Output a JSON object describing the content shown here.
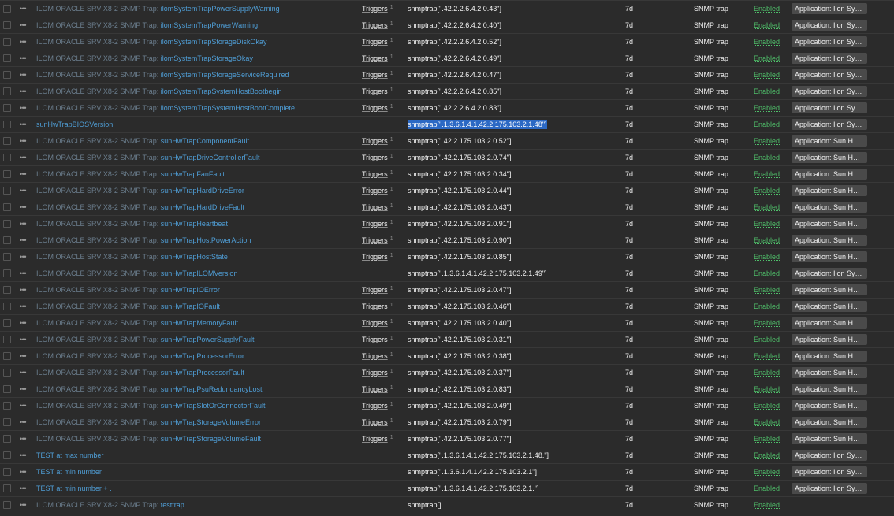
{
  "icons": {
    "row_menu": "more-dots-icon"
  },
  "colors": {
    "background": "#2b2b2b",
    "link": "#4f9ed6",
    "prefix_link": "#6b7e8e",
    "enabled": "#4fbf6a",
    "tag_bg": "#4a4a4a",
    "selection": "#2c69c4"
  },
  "menu_glyph": "•••",
  "rows": [
    {
      "prefix": "ILOM ORACLE SRV X8-2 SNMP Trap: ",
      "name": "ilomSystemTrapPowerSupplyWarning",
      "triggers": "Triggers",
      "triggers_count": "1",
      "key": "snmptrap[\".42.2.2.6.4.2.0.43\"]",
      "key_selected": false,
      "interval": "7d",
      "type": "SNMP trap",
      "status": "Enabled",
      "tag": "Application: Ilon Syste..."
    },
    {
      "prefix": "ILOM ORACLE SRV X8-2 SNMP Trap: ",
      "name": "ilomSystemTrapPowerWarning",
      "triggers": "Triggers",
      "triggers_count": "1",
      "key": "snmptrap[\".42.2.2.6.4.2.0.40\"]",
      "key_selected": false,
      "interval": "7d",
      "type": "SNMP trap",
      "status": "Enabled",
      "tag": "Application: Ilon Syste..."
    },
    {
      "prefix": "ILOM ORACLE SRV X8-2 SNMP Trap: ",
      "name": "ilomSystemTrapStorageDiskOkay",
      "triggers": "Triggers",
      "triggers_count": "1",
      "key": "snmptrap[\".42.2.2.6.4.2.0.52\"]",
      "key_selected": false,
      "interval": "7d",
      "type": "SNMP trap",
      "status": "Enabled",
      "tag": "Application: Ilon Syste..."
    },
    {
      "prefix": "ILOM ORACLE SRV X8-2 SNMP Trap: ",
      "name": "ilomSystemTrapStorageOkay",
      "triggers": "Triggers",
      "triggers_count": "1",
      "key": "snmptrap[\".42.2.2.6.4.2.0.49\"]",
      "key_selected": false,
      "interval": "7d",
      "type": "SNMP trap",
      "status": "Enabled",
      "tag": "Application: Ilon Syste..."
    },
    {
      "prefix": "ILOM ORACLE SRV X8-2 SNMP Trap: ",
      "name": "ilomSystemTrapStorageServiceRequired",
      "triggers": "Triggers",
      "triggers_count": "1",
      "key": "snmptrap[\".42.2.2.6.4.2.0.47\"]",
      "key_selected": false,
      "interval": "7d",
      "type": "SNMP trap",
      "status": "Enabled",
      "tag": "Application: Ilon Syste..."
    },
    {
      "prefix": "ILOM ORACLE SRV X8-2 SNMP Trap: ",
      "name": "ilomSystemTrapSystemHostBootbegin",
      "triggers": "Triggers",
      "triggers_count": "1",
      "key": "snmptrap[\".42.2.2.6.4.2.0.85\"]",
      "key_selected": false,
      "interval": "7d",
      "type": "SNMP trap",
      "status": "Enabled",
      "tag": "Application: Ilon Syste..."
    },
    {
      "prefix": "ILOM ORACLE SRV X8-2 SNMP Trap: ",
      "name": "ilomSystemTrapSystemHostBootComplete",
      "triggers": "Triggers",
      "triggers_count": "1",
      "key": "snmptrap[\".42.2.2.6.4.2.0.83\"]",
      "key_selected": false,
      "interval": "7d",
      "type": "SNMP trap",
      "status": "Enabled",
      "tag": "Application: Ilon Syste..."
    },
    {
      "prefix": "",
      "name": "sunHwTrapBIOSVersion",
      "triggers": "",
      "triggers_count": "",
      "key": "snmptrap[\".1.3.6.1.4.1.42.2.175.103.2.1.48\"]",
      "key_selected": true,
      "interval": "7d",
      "type": "SNMP trap",
      "status": "Enabled",
      "tag": "Application: Ilon Syste..."
    },
    {
      "prefix": "ILOM ORACLE SRV X8-2 SNMP Trap: ",
      "name": "sunHwTrapComponentFault",
      "triggers": "Triggers",
      "triggers_count": "1",
      "key": "snmptrap[\".42.2.175.103.2.0.52\"]",
      "key_selected": false,
      "interval": "7d",
      "type": "SNMP trap",
      "status": "Enabled",
      "tag": "Application: Sun HW T..."
    },
    {
      "prefix": "ILOM ORACLE SRV X8-2 SNMP Trap: ",
      "name": "sunHwTrapDriveControllerFault",
      "triggers": "Triggers",
      "triggers_count": "1",
      "key": "snmptrap[\".42.2.175.103.2.0.74\"]",
      "key_selected": false,
      "interval": "7d",
      "type": "SNMP trap",
      "status": "Enabled",
      "tag": "Application: Sun HW T..."
    },
    {
      "prefix": "ILOM ORACLE SRV X8-2 SNMP Trap: ",
      "name": "sunHwTrapFanFault",
      "triggers": "Triggers",
      "triggers_count": "1",
      "key": "snmptrap[\".42.2.175.103.2.0.34\"]",
      "key_selected": false,
      "interval": "7d",
      "type": "SNMP trap",
      "status": "Enabled",
      "tag": "Application: Sun HW T..."
    },
    {
      "prefix": "ILOM ORACLE SRV X8-2 SNMP Trap: ",
      "name": "sunHwTrapHardDriveError",
      "triggers": "Triggers",
      "triggers_count": "1",
      "key": "snmptrap[\".42.2.175.103.2.0.44\"]",
      "key_selected": false,
      "interval": "7d",
      "type": "SNMP trap",
      "status": "Enabled",
      "tag": "Application: Sun HW T..."
    },
    {
      "prefix": "ILOM ORACLE SRV X8-2 SNMP Trap: ",
      "name": "sunHwTrapHardDriveFault",
      "triggers": "Triggers",
      "triggers_count": "1",
      "key": "snmptrap[\".42.2.175.103.2.0.43\"]",
      "key_selected": false,
      "interval": "7d",
      "type": "SNMP trap",
      "status": "Enabled",
      "tag": "Application: Sun HW T..."
    },
    {
      "prefix": "ILOM ORACLE SRV X8-2 SNMP Trap: ",
      "name": "sunHwTrapHeartbeat",
      "triggers": "Triggers",
      "triggers_count": "1",
      "key": "snmptrap[\".42.2.175.103.2.0.91\"]",
      "key_selected": false,
      "interval": "7d",
      "type": "SNMP trap",
      "status": "Enabled",
      "tag": "Application: Sun HW T..."
    },
    {
      "prefix": "ILOM ORACLE SRV X8-2 SNMP Trap: ",
      "name": "sunHwTrapHostPowerAction",
      "triggers": "Triggers",
      "triggers_count": "1",
      "key": "snmptrap[\".42.2.175.103.2.0.90\"]",
      "key_selected": false,
      "interval": "7d",
      "type": "SNMP trap",
      "status": "Enabled",
      "tag": "Application: Sun HW T..."
    },
    {
      "prefix": "ILOM ORACLE SRV X8-2 SNMP Trap: ",
      "name": "sunHwTrapHostState",
      "triggers": "Triggers",
      "triggers_count": "1",
      "key": "snmptrap[\".42.2.175.103.2.0.85\"]",
      "key_selected": false,
      "interval": "7d",
      "type": "SNMP trap",
      "status": "Enabled",
      "tag": "Application: Sun HW T..."
    },
    {
      "prefix": "ILOM ORACLE SRV X8-2 SNMP Trap: ",
      "name": "sunHwTrapILOMVersion",
      "triggers": "",
      "triggers_count": "",
      "key": "snmptrap[\".1.3.6.1.4.1.42.2.175.103.2.1.49\"]",
      "key_selected": false,
      "interval": "7d",
      "type": "SNMP trap",
      "status": "Enabled",
      "tag": "Application: Ilon Syste..."
    },
    {
      "prefix": "ILOM ORACLE SRV X8-2 SNMP Trap: ",
      "name": "sunHwTrapIOError",
      "triggers": "Triggers",
      "triggers_count": "1",
      "key": "snmptrap[\".42.2.175.103.2.0.47\"]",
      "key_selected": false,
      "interval": "7d",
      "type": "SNMP trap",
      "status": "Enabled",
      "tag": "Application: Sun HW T..."
    },
    {
      "prefix": "ILOM ORACLE SRV X8-2 SNMP Trap: ",
      "name": "sunHwTrapIOFault",
      "triggers": "Triggers",
      "triggers_count": "1",
      "key": "snmptrap[\".42.2.175.103.2.0.46\"]",
      "key_selected": false,
      "interval": "7d",
      "type": "SNMP trap",
      "status": "Enabled",
      "tag": "Application: Sun HW T..."
    },
    {
      "prefix": "ILOM ORACLE SRV X8-2 SNMP Trap: ",
      "name": "sunHwTrapMemoryFault",
      "triggers": "Triggers",
      "triggers_count": "1",
      "key": "snmptrap[\".42.2.175.103.2.0.40\"]",
      "key_selected": false,
      "interval": "7d",
      "type": "SNMP trap",
      "status": "Enabled",
      "tag": "Application: Sun HW T..."
    },
    {
      "prefix": "ILOM ORACLE SRV X8-2 SNMP Trap: ",
      "name": "sunHwTrapPowerSupplyFault",
      "triggers": "Triggers",
      "triggers_count": "1",
      "key": "snmptrap[\".42.2.175.103.2.0.31\"]",
      "key_selected": false,
      "interval": "7d",
      "type": "SNMP trap",
      "status": "Enabled",
      "tag": "Application: Sun HW T..."
    },
    {
      "prefix": "ILOM ORACLE SRV X8-2 SNMP Trap: ",
      "name": "sunHwTrapProcessorError",
      "triggers": "Triggers",
      "triggers_count": "1",
      "key": "snmptrap[\".42.2.175.103.2.0.38\"]",
      "key_selected": false,
      "interval": "7d",
      "type": "SNMP trap",
      "status": "Enabled",
      "tag": "Application: Sun HW T..."
    },
    {
      "prefix": "ILOM ORACLE SRV X8-2 SNMP Trap: ",
      "name": "sunHwTrapProcessorFault",
      "triggers": "Triggers",
      "triggers_count": "1",
      "key": "snmptrap[\".42.2.175.103.2.0.37\"]",
      "key_selected": false,
      "interval": "7d",
      "type": "SNMP trap",
      "status": "Enabled",
      "tag": "Application: Sun HW T..."
    },
    {
      "prefix": "ILOM ORACLE SRV X8-2 SNMP Trap: ",
      "name": "sunHwTrapPsuRedundancyLost",
      "triggers": "Triggers",
      "triggers_count": "1",
      "key": "snmptrap[\".42.2.175.103.2.0.83\"]",
      "key_selected": false,
      "interval": "7d",
      "type": "SNMP trap",
      "status": "Enabled",
      "tag": "Application: Sun HW T..."
    },
    {
      "prefix": "ILOM ORACLE SRV X8-2 SNMP Trap: ",
      "name": "sunHwTrapSlotOrConnectorFault",
      "triggers": "Triggers",
      "triggers_count": "1",
      "key": "snmptrap[\".42.2.175.103.2.0.49\"]",
      "key_selected": false,
      "interval": "7d",
      "type": "SNMP trap",
      "status": "Enabled",
      "tag": "Application: Sun HW T..."
    },
    {
      "prefix": "ILOM ORACLE SRV X8-2 SNMP Trap: ",
      "name": "sunHwTrapStorageVolumeError",
      "triggers": "Triggers",
      "triggers_count": "1",
      "key": "snmptrap[\".42.2.175.103.2.0.79\"]",
      "key_selected": false,
      "interval": "7d",
      "type": "SNMP trap",
      "status": "Enabled",
      "tag": "Application: Sun HW T..."
    },
    {
      "prefix": "ILOM ORACLE SRV X8-2 SNMP Trap: ",
      "name": "sunHwTrapStorageVolumeFault",
      "triggers": "Triggers",
      "triggers_count": "1",
      "key": "snmptrap[\".42.2.175.103.2.0.77\"]",
      "key_selected": false,
      "interval": "7d",
      "type": "SNMP trap",
      "status": "Enabled",
      "tag": "Application: Sun HW T..."
    },
    {
      "prefix": "",
      "name": "TEST at max number",
      "triggers": "",
      "triggers_count": "",
      "key": "snmptrap[\".1.3.6.1.4.1.42.2.175.103.2.1.48.\"]",
      "key_selected": false,
      "interval": "7d",
      "type": "SNMP trap",
      "status": "Enabled",
      "tag": "Application: Ilon Syste..."
    },
    {
      "prefix": "",
      "name": "TEST at min number",
      "triggers": "",
      "triggers_count": "",
      "key": "snmptrap[\".1.3.6.1.4.1.42.2.175.103.2.1\"]",
      "key_selected": false,
      "interval": "7d",
      "type": "SNMP trap",
      "status": "Enabled",
      "tag": "Application: Ilon Syste..."
    },
    {
      "prefix": "",
      "name": "TEST at min number + .",
      "triggers": "",
      "triggers_count": "",
      "key": "snmptrap[\".1.3.6.1.4.1.42.2.175.103.2.1.\"]",
      "key_selected": false,
      "interval": "7d",
      "type": "SNMP trap",
      "status": "Enabled",
      "tag": "Application: Ilon Syste..."
    },
    {
      "prefix": "ILOM ORACLE SRV X8-2 SNMP Trap: ",
      "name": "testtrap",
      "triggers": "",
      "triggers_count": "",
      "key": "snmptrap[]",
      "key_selected": false,
      "interval": "7d",
      "type": "SNMP trap",
      "status": "Enabled",
      "tag": ""
    }
  ]
}
